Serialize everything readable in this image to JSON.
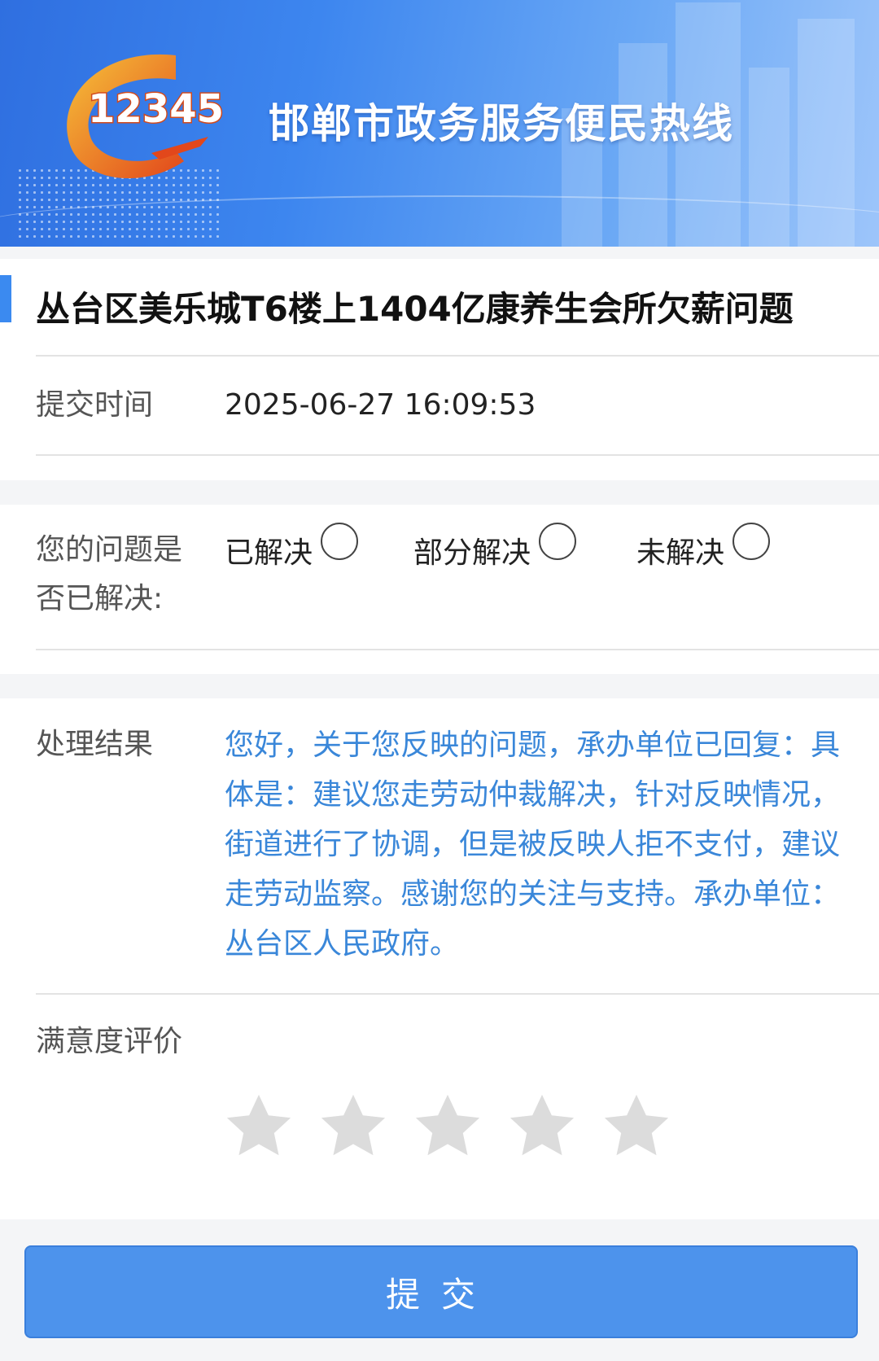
{
  "header": {
    "logo_text": "12345",
    "title": "邯郸市政务服务便民热线"
  },
  "issue": {
    "title": "丛台区美乐城T6楼上1404亿康养生会所欠薪问题",
    "submit_time_label": "提交时间",
    "submit_time": "2025-06-27 16:09:53"
  },
  "resolution": {
    "question_label": "您的问题是否已解决:",
    "options": [
      {
        "label": "已解决",
        "selected": false
      },
      {
        "label": "部分解决",
        "selected": false
      },
      {
        "label": "未解决",
        "selected": false
      }
    ]
  },
  "result": {
    "label": "处理结果",
    "text": "您好，关于您反映的问题，承办单位已回复：具体是：建议您走劳动仲裁解决，针对反映情况，街道进行了协调，但是被反映人拒不支付，建议走劳动监察。感谢您的关注与支持。承办单位：丛台区人民政府。"
  },
  "rating": {
    "label": "满意度评价",
    "max": 5,
    "value": 0
  },
  "submit_label": "提交",
  "colors": {
    "accent": "#3b8af0",
    "result_text": "#3a87d9",
    "button": "#4d93ec",
    "star_inactive": "#dcdcdc"
  }
}
